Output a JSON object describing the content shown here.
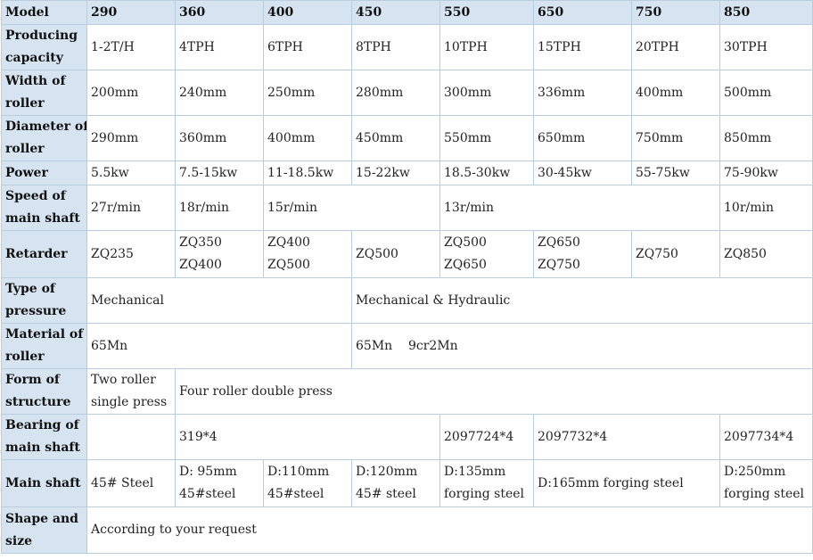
{
  "header": {
    "label": "Model",
    "models": [
      "290",
      "360",
      "400",
      "450",
      "550",
      "650",
      "750",
      "850"
    ]
  },
  "rows": [
    {
      "label": [
        "Producing",
        "capacity"
      ],
      "cells": [
        [
          "1-2T/H"
        ],
        [
          "4TPH"
        ],
        [
          "6TPH"
        ],
        [
          "8TPH"
        ],
        [
          "10TPH"
        ],
        [
          "15TPH"
        ],
        [
          "20TPH"
        ],
        [
          "30TPH"
        ]
      ]
    },
    {
      "label": [
        "Width of",
        "roller"
      ],
      "cells": [
        [
          "200mm"
        ],
        [
          "240mm"
        ],
        [
          "250mm"
        ],
        [
          "280mm"
        ],
        [
          "300mm"
        ],
        [
          "336mm"
        ],
        [
          "400mm"
        ],
        [
          "500mm"
        ]
      ]
    },
    {
      "label": [
        "Diameter of",
        "roller"
      ],
      "cells": [
        [
          "290mm"
        ],
        [
          "360mm"
        ],
        [
          "400mm"
        ],
        [
          "450mm"
        ],
        [
          "550mm"
        ],
        [
          "650mm"
        ],
        [
          "750mm"
        ],
        [
          "850mm"
        ]
      ]
    },
    {
      "label": [
        "Power"
      ],
      "cells": [
        [
          "5.5kw"
        ],
        [
          "7.5-15kw"
        ],
        [
          "11-18.5kw"
        ],
        [
          "15-22kw"
        ],
        [
          "18.5-30kw"
        ],
        [
          "30-45kw"
        ],
        [
          "55-75kw"
        ],
        [
          "75-90kw"
        ]
      ]
    },
    {
      "label": [
        "Speed of",
        "main shaft"
      ],
      "cells": [
        [
          "27r/min"
        ],
        [
          "18r/min"
        ],
        [
          "15r/min"
        ],
        [
          "13r/min"
        ],
        [
          "10r/min"
        ]
      ]
    },
    {
      "label": [
        "Retarder"
      ],
      "cells": [
        [
          "ZQ235"
        ],
        [
          "ZQ350",
          "ZQ400"
        ],
        [
          "ZQ400",
          "ZQ500"
        ],
        [
          "ZQ500"
        ],
        [
          "ZQ500",
          "ZQ650"
        ],
        [
          "ZQ650",
          "ZQ750"
        ],
        [
          "ZQ750"
        ],
        [
          "ZQ850"
        ]
      ]
    },
    {
      "label": [
        "Type of",
        "pressure"
      ],
      "cells": [
        [
          "Mechanical"
        ],
        [
          "Mechanical & Hydraulic"
        ]
      ]
    },
    {
      "label": [
        "Material of",
        "roller"
      ],
      "cells": [
        [
          "65Mn"
        ],
        [
          "65Mn    9cr2Mn"
        ]
      ]
    },
    {
      "label": [
        "Form of",
        "structure"
      ],
      "cells": [
        [
          "Two roller",
          "single press"
        ],
        [
          "Four roller double press"
        ]
      ]
    },
    {
      "label": [
        "Bearing of",
        "main shaft"
      ],
      "cells": [
        [
          ""
        ],
        [
          "319*4"
        ],
        [
          "2097724*4"
        ],
        [
          "2097732*4"
        ],
        [
          "2097734*4"
        ]
      ]
    },
    {
      "label": [
        "Main shaft"
      ],
      "cells": [
        [
          "45# Steel"
        ],
        [
          "D: 95mm",
          "45#steel"
        ],
        [
          "D:110mm",
          "45#steel"
        ],
        [
          "D:120mm",
          "45# steel"
        ],
        [
          "D:135mm",
          "forging steel"
        ],
        [
          "D:165mm forging steel"
        ],
        [
          "D:250mm",
          "forging steel"
        ]
      ]
    },
    {
      "label": [
        "Shape and",
        "size"
      ],
      "cells": [
        [
          "According to your request"
        ]
      ]
    }
  ]
}
